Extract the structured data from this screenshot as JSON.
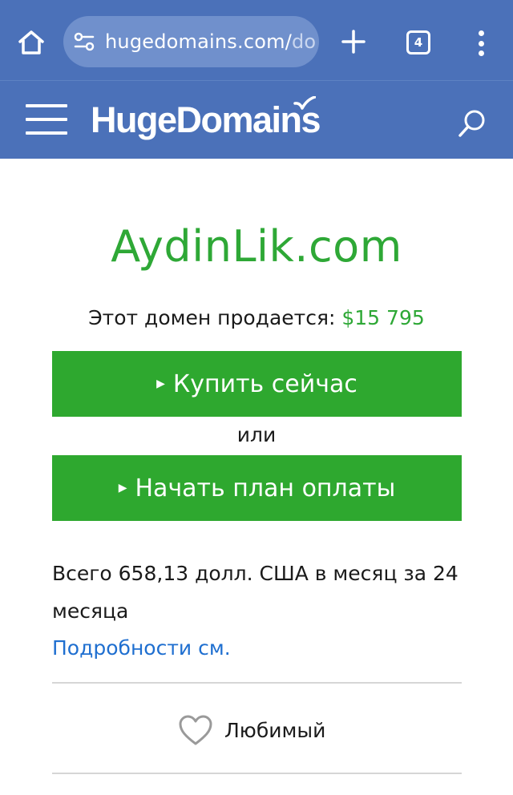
{
  "browser": {
    "url_visible": "hugedomains.com/",
    "url_faded": "do",
    "tab_count": "4",
    "icons": [
      "home-icon",
      "site-settings-icon",
      "new-tab-plus-icon",
      "tab-switcher-icon",
      "overflow-menu-icon"
    ]
  },
  "site_header": {
    "logo_text": "HugeDomains",
    "icons": [
      "hamburger-menu-icon",
      "search-icon"
    ]
  },
  "listing": {
    "domain": "AydinLik.com",
    "price_prefix": "Этот домен продается:",
    "price": "$15 795",
    "buy_now_label": "Купить сейчас",
    "or_label": "или",
    "payment_plan_label": "Начать план оплаты",
    "monthly_text": "Всего 658,13 долл. США в месяц за 24 месяца",
    "details_link": "Подробности см.",
    "favorite_label": "Любимый"
  },
  "colors": {
    "header_blue": "#4b71b9",
    "url_pill": "#7090cc",
    "brand_green": "#2ea836",
    "link_blue": "#1f6fd0"
  }
}
